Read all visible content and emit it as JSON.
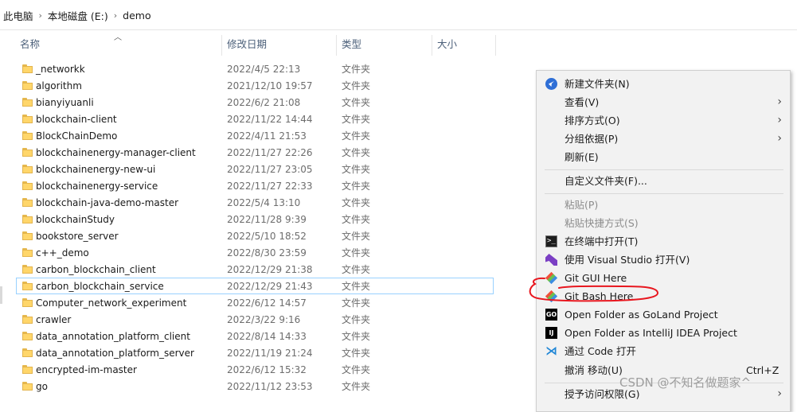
{
  "breadcrumb": {
    "items": [
      "此电脑",
      "本地磁盘 (E:)",
      "demo"
    ],
    "separator": "›"
  },
  "columns": {
    "name": "名称",
    "date": "修改日期",
    "type": "类型",
    "size": "大小"
  },
  "files": [
    {
      "name": "_networkk",
      "date": "2022/4/5 22:13",
      "type": "文件夹"
    },
    {
      "name": "algorithm",
      "date": "2021/12/10 19:57",
      "type": "文件夹"
    },
    {
      "name": "bianyiyuanli",
      "date": "2022/6/2 21:08",
      "type": "文件夹"
    },
    {
      "name": "blockchain-client",
      "date": "2022/11/22 14:44",
      "type": "文件夹"
    },
    {
      "name": "BlockChainDemo",
      "date": "2022/4/11 21:53",
      "type": "文件夹"
    },
    {
      "name": "blockchainenergy-manager-client",
      "date": "2022/11/27 22:26",
      "type": "文件夹"
    },
    {
      "name": "blockchainenergy-new-ui",
      "date": "2022/11/27 23:05",
      "type": "文件夹"
    },
    {
      "name": "blockchainenergy-service",
      "date": "2022/11/27 22:33",
      "type": "文件夹"
    },
    {
      "name": "blockchain-java-demo-master",
      "date": "2022/5/4 13:10",
      "type": "文件夹"
    },
    {
      "name": "blockchainStudy",
      "date": "2022/11/28 9:39",
      "type": "文件夹"
    },
    {
      "name": "bookstore_server",
      "date": "2022/5/10 18:52",
      "type": "文件夹"
    },
    {
      "name": "c++_demo",
      "date": "2022/8/30 23:59",
      "type": "文件夹"
    },
    {
      "name": "carbon_blockchain_client",
      "date": "2022/12/29 21:38",
      "type": "文件夹"
    },
    {
      "name": "carbon_blockchain_service",
      "date": "2022/12/29 21:43",
      "type": "文件夹",
      "selected": true
    },
    {
      "name": "Computer_network_experiment",
      "date": "2022/6/12 14:57",
      "type": "文件夹"
    },
    {
      "name": "crawler",
      "date": "2022/3/22 9:16",
      "type": "文件夹"
    },
    {
      "name": "data_annotation_platform_client",
      "date": "2022/8/14 14:33",
      "type": "文件夹"
    },
    {
      "name": "data_annotation_platform_server",
      "date": "2022/11/19 21:24",
      "type": "文件夹"
    },
    {
      "name": "encrypted-im-master",
      "date": "2022/6/12 15:32",
      "type": "文件夹"
    },
    {
      "name": "go",
      "date": "2022/11/12 23:53",
      "type": "文件夹"
    }
  ],
  "context_menu": {
    "new_folder": "新建文件夹(N)",
    "view": "查看(V)",
    "sort_by": "排序方式(O)",
    "group_by": "分组依据(P)",
    "refresh": "刷新(E)",
    "customize": "自定义文件夹(F)...",
    "paste": "粘贴(P)",
    "paste_shortcut": "粘贴快捷方式(S)",
    "open_terminal": "在终端中打开(T)",
    "open_vs": "使用 Visual Studio 打开(V)",
    "git_gui": "Git GUI Here",
    "git_bash": "Git Bash Here",
    "goland": "Open Folder as GoLand Project",
    "intellij": "Open Folder as IntelliJ IDEA Project",
    "vscode": "通过 Code 打开",
    "undo_move": "撤消 移动(U)",
    "undo_shortcut": "Ctrl+Z",
    "grant_access": "授予访问权限(G)",
    "submenu_arrow": "›"
  },
  "icons": {
    "go_icon_text": "GO",
    "ij_icon_text": "IJ",
    "code_icon_glyph": "⋊"
  },
  "watermark": "CSDN @不知名做题家^",
  "colors": {
    "selection_border": "#99d1ff",
    "annotation": "#e8171f",
    "folder": "#ffd66a"
  }
}
